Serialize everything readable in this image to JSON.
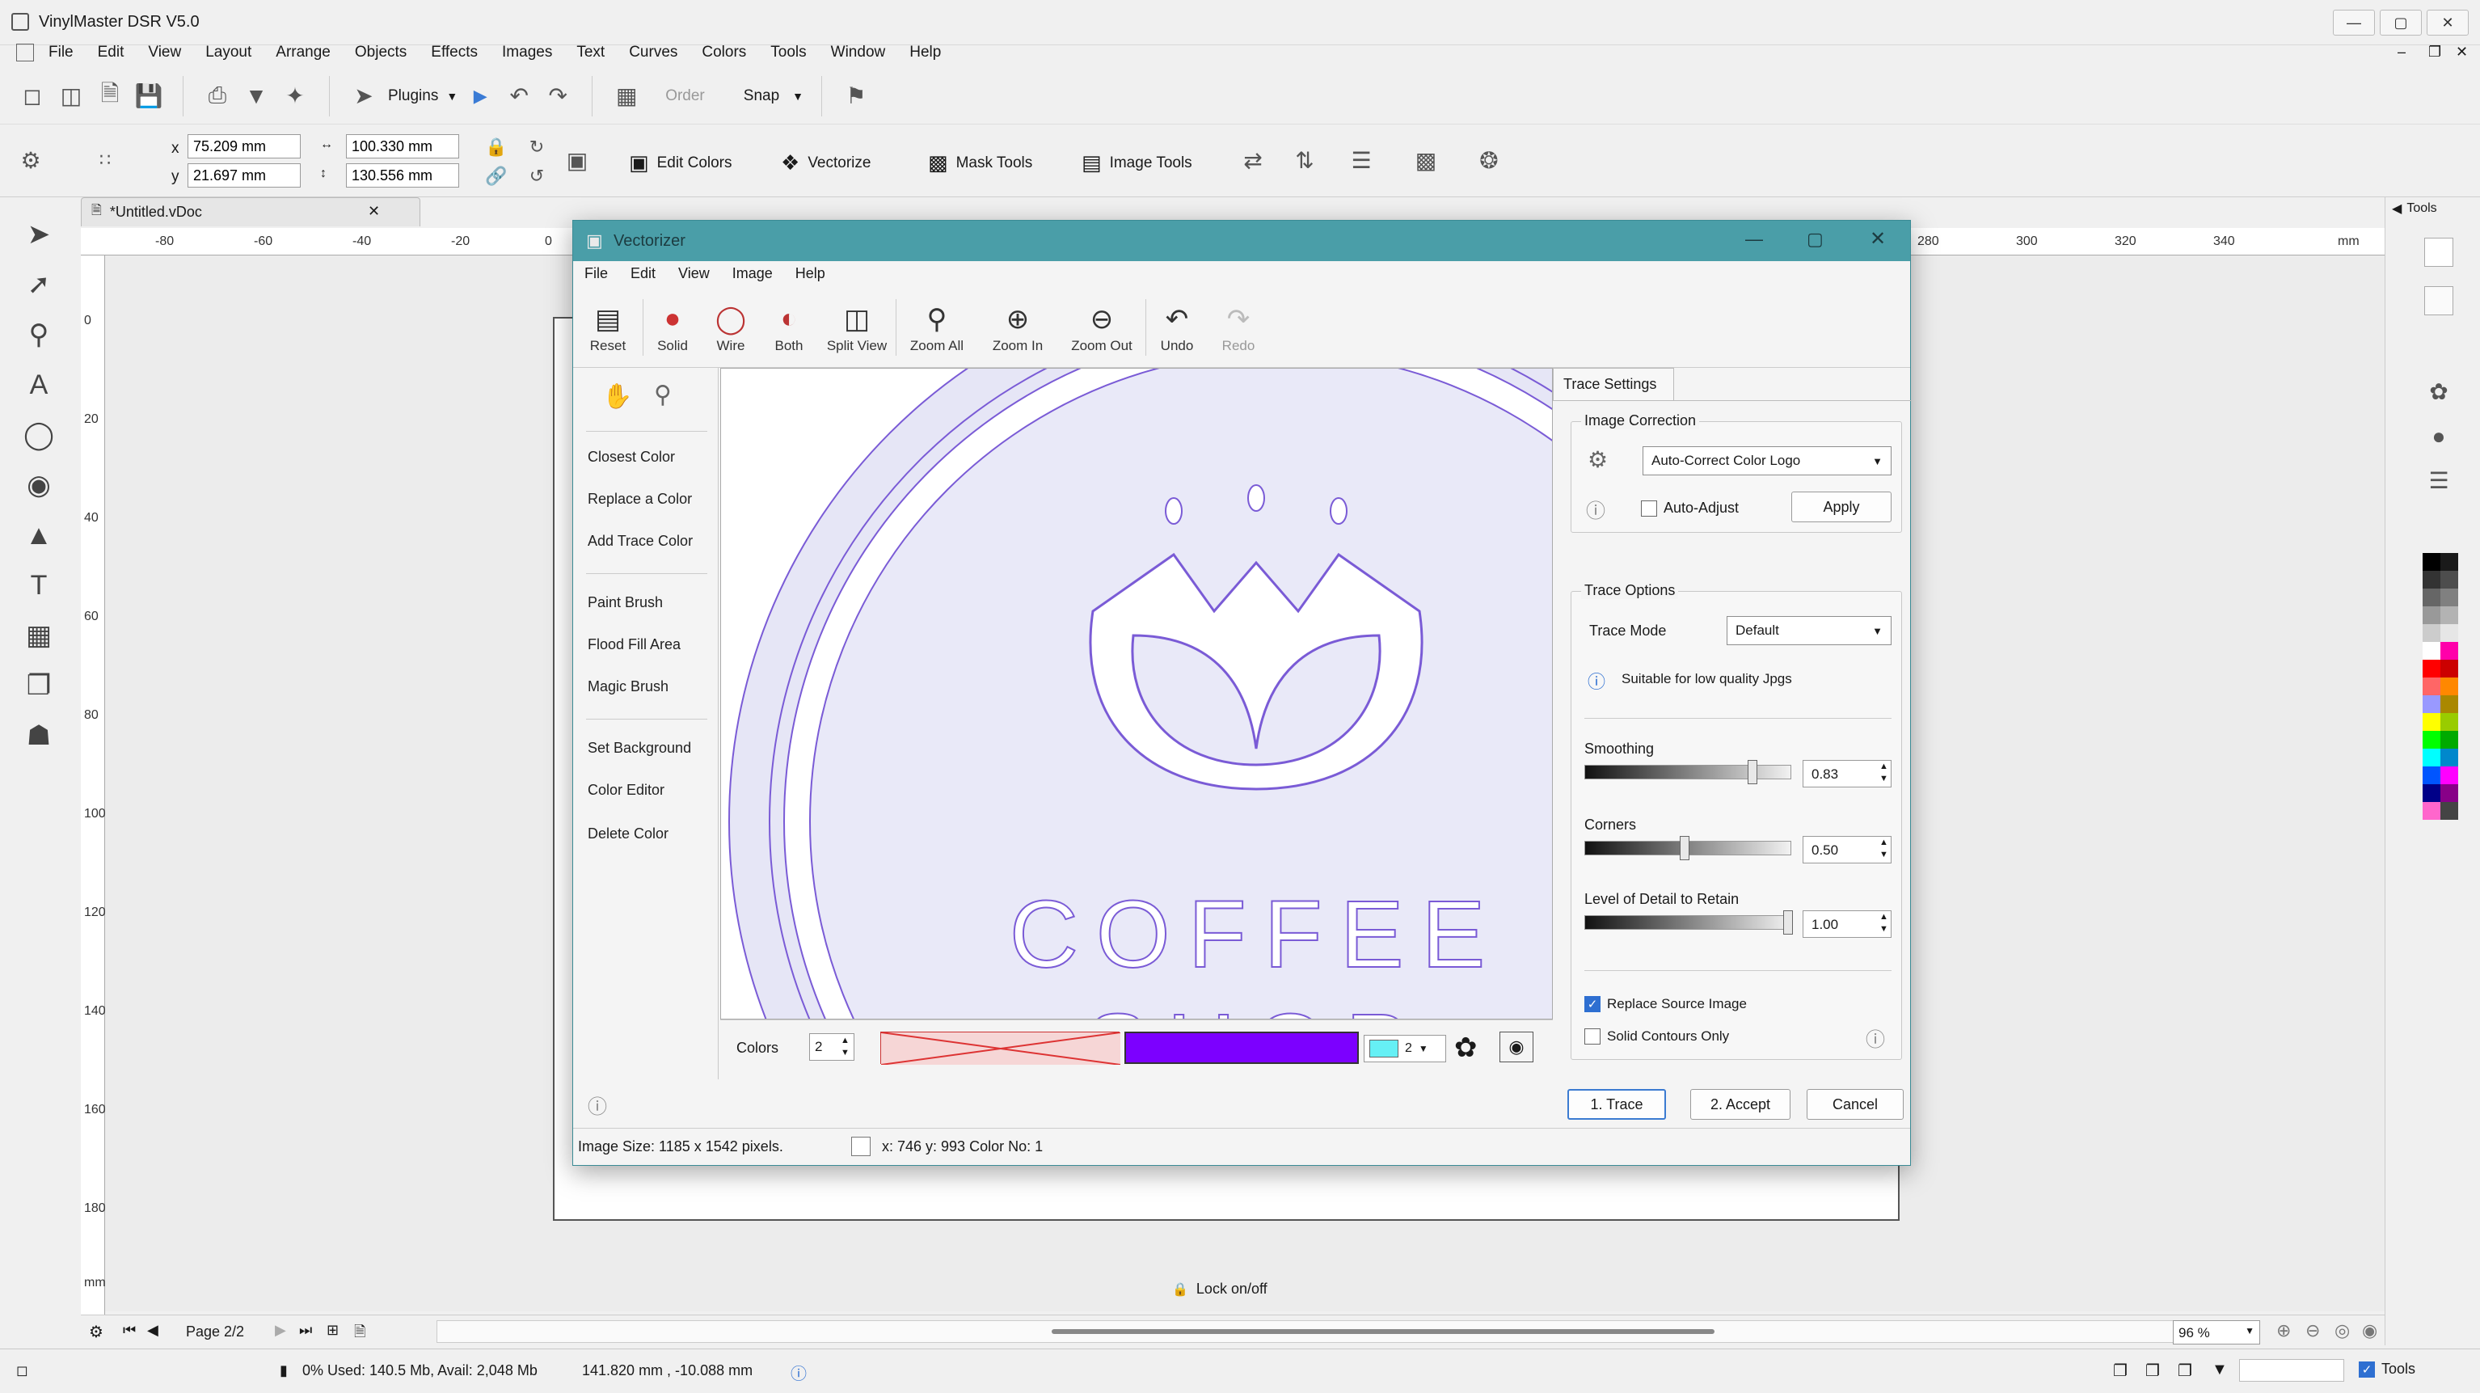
{
  "app": {
    "title": "VinylMaster DSR V5.0",
    "menu": [
      "File",
      "Edit",
      "View",
      "Layout",
      "Arrange",
      "Objects",
      "Effects",
      "Images",
      "Text",
      "Curves",
      "Colors",
      "Tools",
      "Window",
      "Help"
    ]
  },
  "toolbar": {
    "plugins_label": "Plugins",
    "order_label": "Order",
    "snap_label": "Snap",
    "x_label": "x",
    "y_label": "y",
    "x_value": "75.209 mm",
    "y_value": "21.697 mm",
    "w_value": "100.330 mm",
    "h_value": "130.556 mm",
    "edit_colors_label": "Edit Colors",
    "vectorize_label": "Vectorize",
    "mask_tools_label": "Mask Tools",
    "image_tools_label": "Image Tools"
  },
  "document": {
    "tab_label": "*Untitled.vDoc",
    "lock_label": "Lock on/off",
    "ruler_top": [
      "-80",
      "-60",
      "-40",
      "-20",
      "0",
      "280",
      "300",
      "320",
      "340",
      "mm"
    ],
    "ruler_left": [
      "0",
      "20",
      "40",
      "60",
      "80",
      "100",
      "120",
      "140",
      "160",
      "180",
      "mm"
    ]
  },
  "pagebar": {
    "page_label": "Page 2/2",
    "zoom_value": "96 %"
  },
  "statusbar": {
    "memory": "0%   Used: 140.5 Mb, Avail: 2,048 Mb",
    "coords": "141.820 mm , -10.088 mm",
    "tools_label": "Tools"
  },
  "right_panel": {
    "tools_label": "Tools"
  },
  "dialog": {
    "title": "Vectorizer",
    "menu": [
      "File",
      "Edit",
      "View",
      "Image",
      "Help"
    ],
    "tools": [
      {
        "label": "Reset",
        "icon": "reset-icon"
      },
      {
        "label": "Solid",
        "icon": "solid-icon"
      },
      {
        "label": "Wire",
        "icon": "wire-icon"
      },
      {
        "label": "Both",
        "icon": "both-icon"
      },
      {
        "label": "Split View",
        "icon": "split-view-icon"
      },
      {
        "label": "Zoom All",
        "icon": "zoom-all-icon"
      },
      {
        "label": "Zoom In",
        "icon": "zoom-in-icon"
      },
      {
        "label": "Zoom Out",
        "icon": "zoom-out-icon"
      },
      {
        "label": "Undo",
        "icon": "undo-icon"
      },
      {
        "label": "Redo",
        "icon": "redo-icon"
      }
    ],
    "left_items": {
      "closest_color": "Closest Color",
      "replace_color": "Replace a Color",
      "add_trace_color": "Add Trace Color",
      "paint_brush": "Paint Brush",
      "flood_fill": "Flood Fill Area",
      "magic_brush": "Magic Brush",
      "set_background": "Set Background",
      "color_editor": "Color Editor",
      "delete_color": "Delete Color"
    },
    "preview": {
      "text_line1": "COFFEE",
      "text_line2": "SHOP"
    },
    "colors": {
      "label": "Colors",
      "count": "2",
      "swatch_count": "2",
      "color1": "#7c00ff",
      "color_bg": "#f6d6d6"
    },
    "trace_settings": {
      "tab_label": "Trace Settings",
      "image_correction_title": "Image Correction",
      "correction_value": "Auto-Correct Color Logo",
      "auto_adjust_label": "Auto-Adjust",
      "auto_adjust_checked": false,
      "apply_label": "Apply",
      "trace_options_title": "Trace Options",
      "trace_mode_label": "Trace Mode",
      "trace_mode_value": "Default",
      "hint": "Suitable for low quality Jpgs",
      "smoothing_label": "Smoothing",
      "smoothing_value": "0.83",
      "corners_label": "Corners",
      "corners_value": "0.50",
      "detail_label": "Level of Detail to Retain",
      "detail_value": "1.00",
      "replace_source_label": "Replace Source Image",
      "replace_source_checked": true,
      "solid_contours_label": "Solid Contours Only",
      "solid_contours_checked": false
    },
    "footer": {
      "trace_label": "1. Trace",
      "accept_label": "2. Accept",
      "cancel_label": "Cancel"
    },
    "status": {
      "image_size": "Image Size: 1185 x 1542 pixels.",
      "cursor": "x: 746 y: 993  Color No: 1"
    }
  },
  "palette": [
    "#000000",
    "#1a1a1a",
    "#333333",
    "#4d4d4d",
    "#666666",
    "#808080",
    "#999999",
    "#b3b3b3",
    "#cccccc",
    "#e6e6e6",
    "#ffffff",
    "#ff00aa",
    "#ff0000",
    "#cc0000",
    "#ff6666",
    "#ff8800",
    "#9999ff",
    "#aa8800",
    "#ffff00",
    "#99cc00",
    "#00ff00",
    "#00aa00",
    "#00ffff",
    "#0088cc",
    "#0055ff",
    "#ff00ff",
    "#000088",
    "#880088",
    "#ff66cc",
    "#444444"
  ]
}
